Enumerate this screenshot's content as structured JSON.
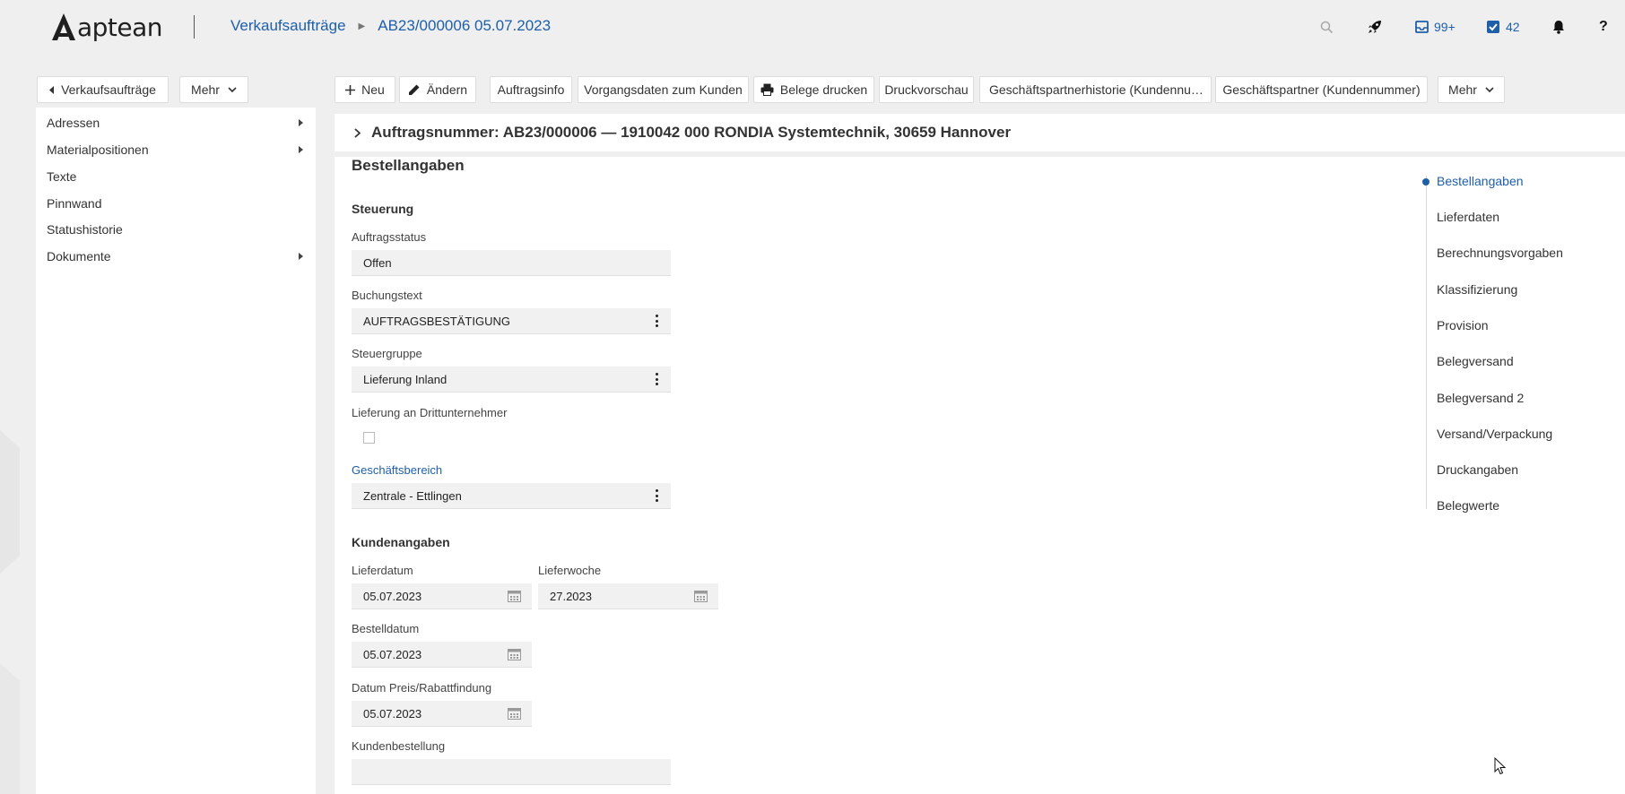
{
  "header": {
    "logo_text": "aptean",
    "breadcrumb": [
      "Verkaufsaufträge",
      "AB23/000006 05.07.2023"
    ],
    "inbox_count": "99+",
    "tasks_count": "42",
    "help_label": "?"
  },
  "toolbar": {
    "back_label": "Verkaufsaufträge",
    "more_left_label": "Mehr",
    "new_label": "Neu",
    "edit_label": "Ändern",
    "orderinfo_label": "Auftragsinfo",
    "customer_data_label": "Vorgangsdaten zum Kunden",
    "print_docs_label": "Belege drucken",
    "preview_label": "Druckvorschau",
    "partner_history_label": "Geschäftspartnerhistorie (Kundennu…",
    "partner_label": "Geschäftspartner (Kundennummer)",
    "more_right_label": "Mehr"
  },
  "sidebar": {
    "items": [
      {
        "label": "Adressen",
        "has_arrow": true
      },
      {
        "label": "Materialpositionen",
        "has_arrow": true
      },
      {
        "label": "Texte",
        "has_arrow": false
      },
      {
        "label": "Pinnwand",
        "has_arrow": false
      },
      {
        "label": "Statushistorie",
        "has_arrow": false
      },
      {
        "label": "Dokumente",
        "has_arrow": true
      }
    ]
  },
  "main": {
    "title": "Auftragsnummer: AB23/000006 — 1910042 000 RONDIA Systemtechnik, 30659 Hannover",
    "section_title": "Bestellangaben",
    "steuerung": {
      "title": "Steuerung",
      "auftragsstatus_label": "Auftragsstatus",
      "auftragsstatus_value": "Offen",
      "buchungstext_label": "Buchungstext",
      "buchungstext_value": "AUFTRAGSBESTÄTIGUNG",
      "steuergruppe_label": "Steuergruppe",
      "steuergruppe_value": "Lieferung Inland",
      "drittunternehmer_label": "Lieferung an Drittunternehmer",
      "drittunternehmer_checked": false,
      "geschaeftsbereich_label": "Geschäftsbereich",
      "geschaeftsbereich_value": "Zentrale - Ettlingen"
    },
    "kundenangaben": {
      "title": "Kundenangaben",
      "lieferdatum_label": "Lieferdatum",
      "lieferdatum_value": "05.07.2023",
      "lieferwoche_label": "Lieferwoche",
      "lieferwoche_value": "27.2023",
      "bestelldatum_label": "Bestelldatum",
      "bestelldatum_value": "05.07.2023",
      "preisdatum_label": "Datum Preis/Rabattfindung",
      "preisdatum_value": "05.07.2023",
      "kundenbestellung_label": "Kundenbestellung",
      "kundenbestellung_value": ""
    }
  },
  "right_nav": {
    "items": [
      "Bestellangaben",
      "Lieferdaten",
      "Berechnungsvorgaben",
      "Klassifizierung",
      "Provision",
      "Belegversand",
      "Belegversand 2",
      "Versand/Verpackung",
      "Druckangaben",
      "Belegwerte"
    ],
    "active_index": 0
  },
  "colors": {
    "accent": "#1e5fa8",
    "background": "#efefef",
    "field_bg": "#f1f1f1"
  }
}
